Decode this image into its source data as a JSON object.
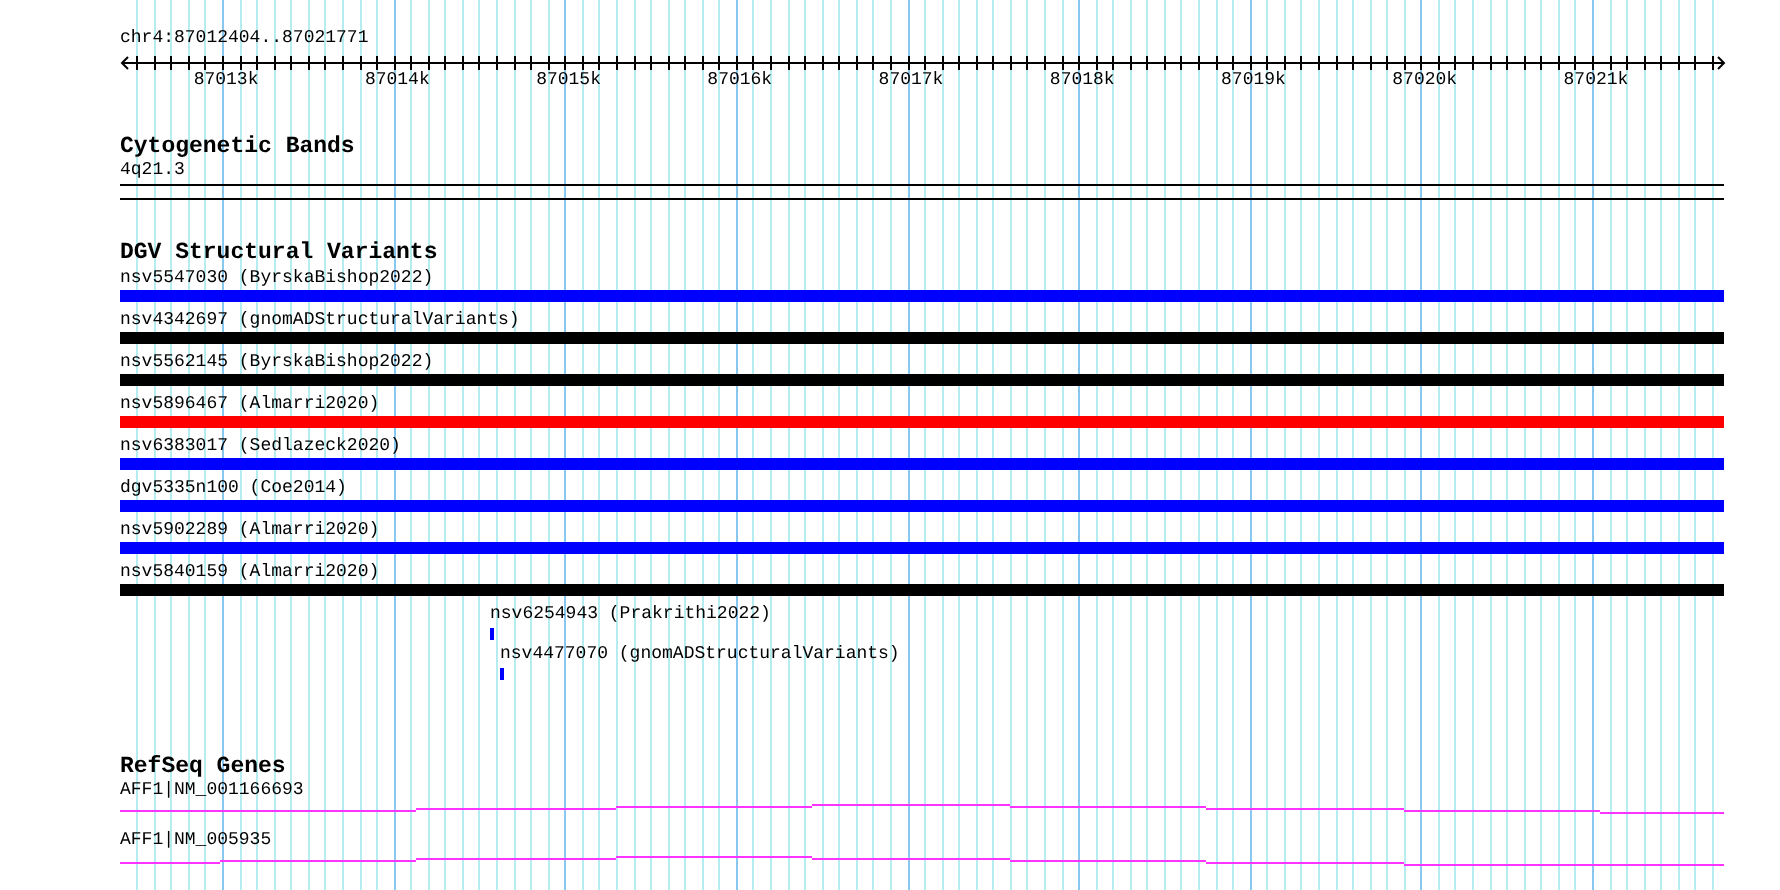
{
  "location": "chr4:87012404..87021771",
  "ruler": {
    "ticks": [
      "87013k",
      "87014k",
      "87015k",
      "87016k",
      "87017k",
      "87018k",
      "87019k",
      "87020k",
      "87021k"
    ]
  },
  "cytogenetic_bands": {
    "title": "Cytogenetic Bands",
    "band": "4q21.3"
  },
  "dgv_structural_variants": {
    "title": "DGV Structural Variants",
    "variants": [
      {
        "label": "nsv5547030 (ByrskaBishop2022)",
        "kind": "spanning",
        "color": "#0000ff"
      },
      {
        "label": "nsv4342697 (gnomADStructuralVariants)",
        "kind": "spanning",
        "color": "#000000"
      },
      {
        "label": "nsv5562145 (ByrskaBishop2022)",
        "kind": "spanning",
        "color": "#000000"
      },
      {
        "label": "nsv5896467 (Almarri2020)",
        "kind": "spanning",
        "color": "#ff0000"
      },
      {
        "label": "nsv6383017 (Sedlazeck2020)",
        "kind": "spanning",
        "color": "#0000ff"
      },
      {
        "label": "dgv5335n100 (Coe2014)",
        "kind": "spanning",
        "color": "#0000ff"
      },
      {
        "label": "nsv5902289 (Almarri2020)",
        "kind": "spanning",
        "color": "#0000ff"
      },
      {
        "label": "nsv5840159 (Almarri2020)",
        "kind": "spanning",
        "color": "#000000"
      },
      {
        "label": "nsv6254943 (Prakrithi2022)",
        "kind": "small",
        "color": "#0000ff"
      },
      {
        "label": "nsv4477070 (gnomADStructuralVariants)",
        "kind": "small",
        "color": "#0000ff"
      }
    ]
  },
  "refseq_genes": {
    "title": "RefSeq Genes",
    "genes": [
      {
        "label": "AFF1|NM_001166693"
      },
      {
        "label": "AFF1|NM_005935"
      }
    ]
  }
}
